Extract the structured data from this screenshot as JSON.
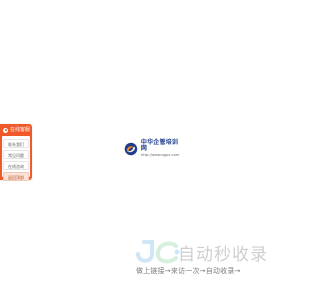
{
  "side_panel": {
    "header": "在线客服",
    "items": [
      {
        "label": "联系我们"
      },
      {
        "label": "常见问题"
      },
      {
        "label": "在线咨询"
      },
      {
        "label": "返回顶部"
      }
    ]
  },
  "center_logo": {
    "title": "中华企管培训网",
    "url": "http://www.qgpx.com"
  },
  "brand": {
    "title": "自动秒收录",
    "slogan": "做上链接→来访一次→自动收录→"
  },
  "colors": {
    "panel_orange": "#f05a2a",
    "logo_blue": "#1f3d8a",
    "logo_orange": "#f08a1a",
    "watermark_gray": "#cfcfcf",
    "slogan_gray": "#7c7c7c"
  }
}
